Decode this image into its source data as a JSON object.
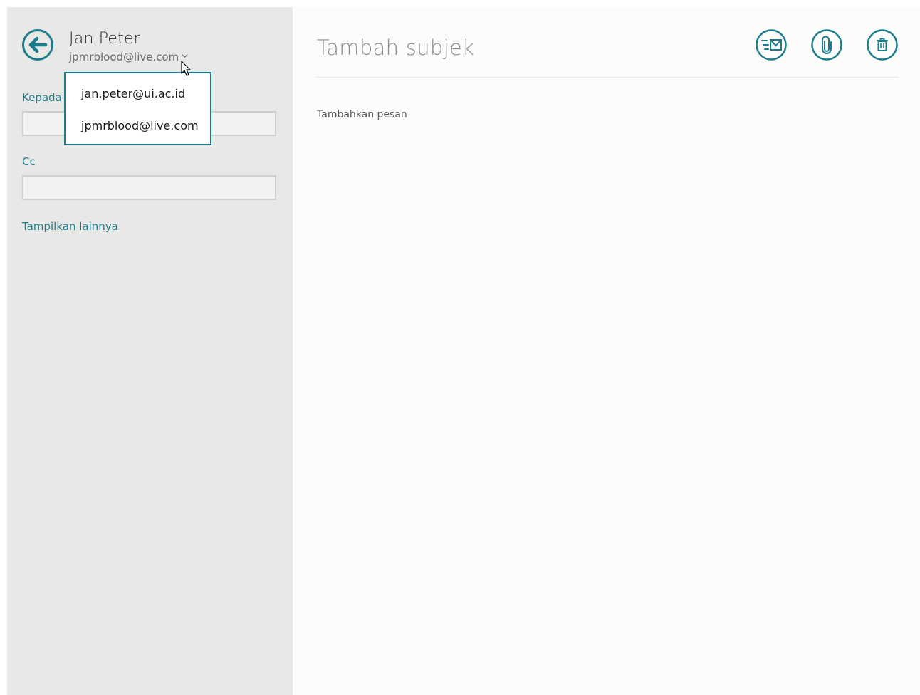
{
  "accent_color": "#1b7c8b",
  "header": {
    "back_icon": "back-arrow-icon",
    "sender_name": "Jan Peter",
    "sender_account": "jpmrblood@live.com",
    "account_chevron_icon": "chevron-down-icon"
  },
  "account_dropdown": {
    "options": [
      {
        "label": "jan.peter@ui.ac.id"
      },
      {
        "label": "jpmrblood@live.com"
      }
    ]
  },
  "fields": {
    "to_label": "Kepada",
    "cc_label": "Cc",
    "to_value": "",
    "cc_value": ""
  },
  "show_more": "Tampilkan lainnya",
  "compose": {
    "subject_placeholder": "Tambah subjek",
    "body_placeholder": "Tambahkan pesan"
  },
  "toolbar": {
    "send_icon": "send-mail-icon",
    "attach_icon": "paperclip-icon",
    "delete_icon": "trash-icon"
  }
}
